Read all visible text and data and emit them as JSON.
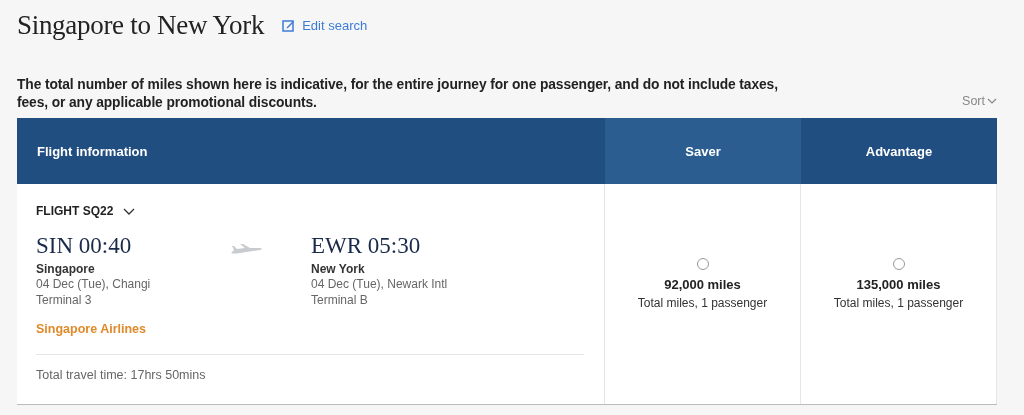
{
  "title": "Singapore to New York",
  "edit_link": "Edit search",
  "notice": "The total number of miles shown here is indicative, for the entire journey for one passenger, and do not include taxes, fees, or any applicable promotional discounts.",
  "sort": "Sort",
  "table": {
    "flight_header": "Flight information",
    "fare_columns": [
      {
        "label": "Saver",
        "highlighted": true
      },
      {
        "label": "Advantage",
        "highlighted": false
      }
    ],
    "flight": {
      "number": "FLIGHT SQ22",
      "expanded": false,
      "departure": {
        "code_time": "SIN 00:40",
        "city": "Singapore",
        "date_airport": "04 Dec (Tue), Changi",
        "terminal": "Terminal 3"
      },
      "arrival": {
        "code_time": "EWR 05:30",
        "city": "New York",
        "date_airport": "04 Dec (Tue), Newark Intl",
        "terminal": "Terminal B"
      },
      "airline": "Singapore Airlines",
      "travel_time": "Total travel time: 17hrs 50mins"
    },
    "fares": [
      {
        "miles": "92,000 miles",
        "note": "Total miles, 1 passenger",
        "selected": false
      },
      {
        "miles": "135,000 miles",
        "note": "Total miles, 1 passenger",
        "selected": false
      }
    ]
  }
}
